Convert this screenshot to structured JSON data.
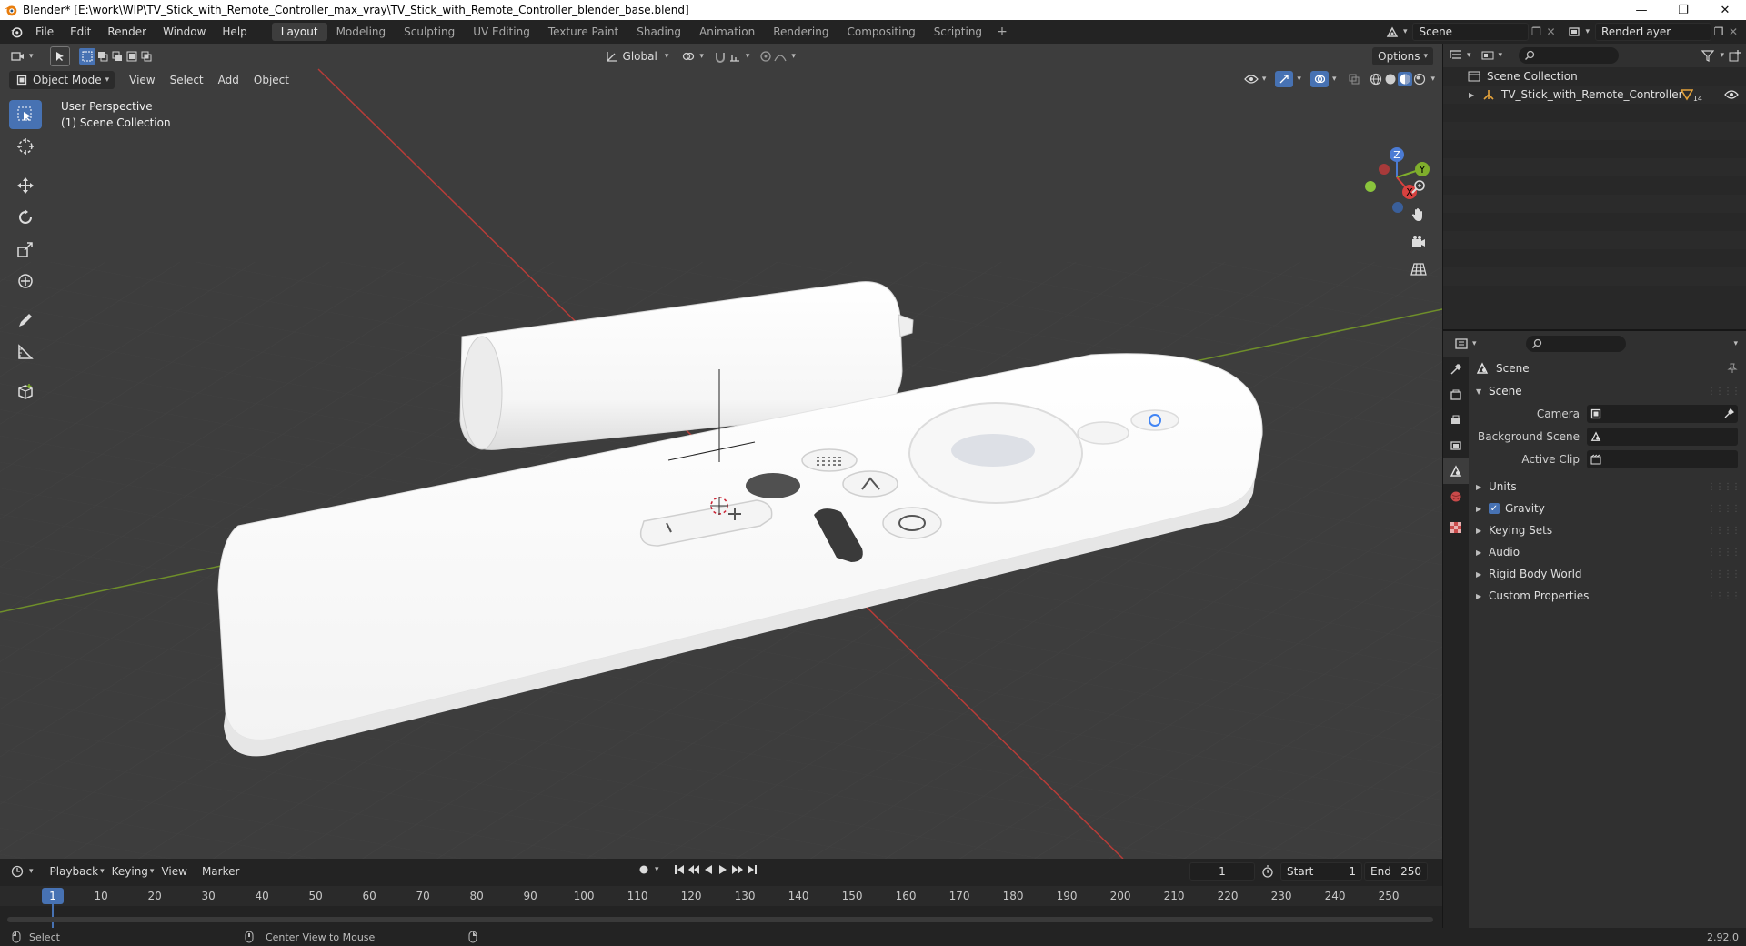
{
  "window": {
    "title": "Blender* [E:\\work\\WIP\\TV_Stick_with_Remote_Controller_max_vray\\TV_Stick_with_Remote_Controller_blender_base.blend]",
    "minimize": "—",
    "restore": "❐",
    "close": "✕"
  },
  "menu": [
    "File",
    "Edit",
    "Render",
    "Window",
    "Help"
  ],
  "workspaces": [
    "Layout",
    "Modeling",
    "Sculpting",
    "UV Editing",
    "Texture Paint",
    "Shading",
    "Animation",
    "Rendering",
    "Compositing",
    "Scripting"
  ],
  "workspace_add": "+",
  "scene_field": "Scene",
  "renderlayer_field": "RenderLayer",
  "viewport": {
    "mode": "Object Mode",
    "menu": [
      "View",
      "Select",
      "Add",
      "Object"
    ],
    "orientation": "Global",
    "options": "Options",
    "overlay_line1": "User Perspective",
    "overlay_line2": "(1) Scene Collection",
    "gizmo": {
      "z": "Z",
      "y": "Y",
      "x": "X"
    }
  },
  "timeline": {
    "menu": [
      "Playback",
      "Keying",
      "View",
      "Marker"
    ],
    "current_frame": "1",
    "start_label": "Start",
    "start_value": "1",
    "end_label": "End",
    "end_value": "250",
    "ticks": [
      "1",
      "10",
      "20",
      "30",
      "40",
      "50",
      "60",
      "70",
      "80",
      "90",
      "100",
      "110",
      "120",
      "130",
      "140",
      "150",
      "160",
      "170",
      "180",
      "190",
      "200",
      "210",
      "220",
      "230",
      "240",
      "250"
    ]
  },
  "status": {
    "select": "Select",
    "center_view": "Center View to Mouse",
    "version": "2.92.0"
  },
  "outliner": {
    "root": "Scene Collection",
    "items": [
      {
        "name": "TV_Stick_with_Remote_Controller",
        "badge": "14"
      }
    ]
  },
  "properties": {
    "header": "Scene",
    "panel": "Scene",
    "rows": [
      {
        "label": "Camera"
      },
      {
        "label": "Background Scene"
      },
      {
        "label": "Active Clip"
      }
    ],
    "subpanels": [
      "Units",
      "Gravity",
      "Keying Sets",
      "Audio",
      "Rigid Body World",
      "Custom Properties"
    ]
  },
  "colors": {
    "accent": "#4772b3",
    "viewport_bg": "#3d3d3d",
    "x_axis": "#c2413b",
    "y_axis": "#7a9e2a"
  }
}
